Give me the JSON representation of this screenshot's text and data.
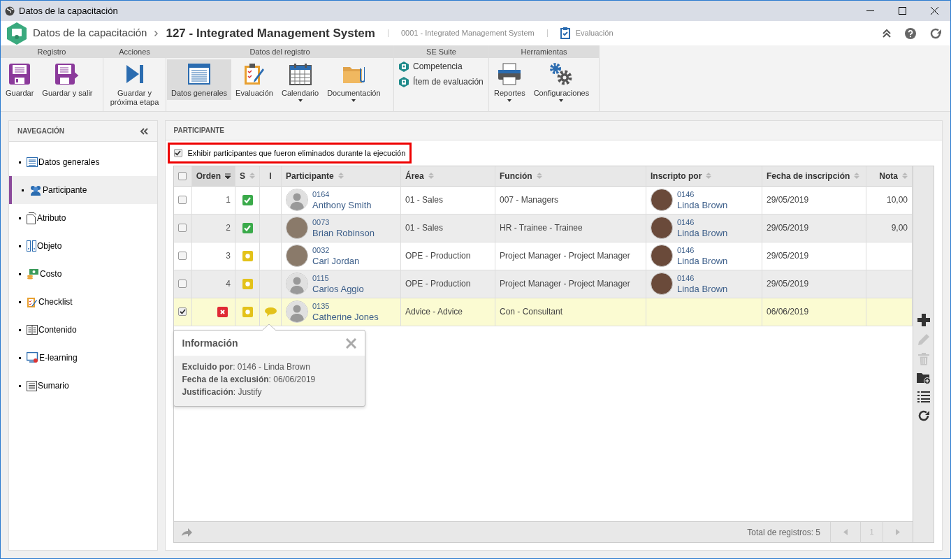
{
  "window": {
    "title": "Datos de la capacitación"
  },
  "header": {
    "module": "Datos de la capacitación",
    "record": "127 - Integrated Management System",
    "subrecord": "0001 - Integrated Management System",
    "step": "Evaluación"
  },
  "ribbon": [
    {
      "label": "Registro",
      "items": [
        {
          "kind": "large",
          "label": "Guardar",
          "selected": false,
          "dropdown": false
        },
        {
          "kind": "large",
          "label": "Guardar y salir",
          "selected": false,
          "dropdown": false
        }
      ]
    },
    {
      "label": "Acciones",
      "items": [
        {
          "kind": "large",
          "label": "Guardar y próxima etapa",
          "selected": false,
          "dropdown": false
        }
      ]
    },
    {
      "label": "Datos del registro",
      "items": [
        {
          "kind": "large",
          "label": "Datos generales",
          "selected": true,
          "dropdown": false
        },
        {
          "kind": "large",
          "label": "Evaluación",
          "selected": false,
          "dropdown": false
        },
        {
          "kind": "large",
          "label": "Calendario",
          "selected": false,
          "dropdown": true
        },
        {
          "kind": "large",
          "label": "Documentación",
          "selected": false,
          "dropdown": true
        }
      ]
    },
    {
      "label": "SE Suite",
      "items": [
        {
          "kind": "small",
          "label": "Competencia",
          "selected": false
        },
        {
          "kind": "small",
          "label": "Ítem de evaluación",
          "selected": false
        }
      ]
    },
    {
      "label": "Herramientas",
      "items": [
        {
          "kind": "large",
          "label": "Reportes",
          "selected": false,
          "dropdown": true
        },
        {
          "kind": "large",
          "label": "Configuraciones",
          "selected": false,
          "dropdown": true
        }
      ]
    }
  ],
  "navigation": {
    "title": "NAVEGACIÓN",
    "items": [
      {
        "label": "Datos generales",
        "selected": false
      },
      {
        "label": "Participante",
        "selected": true
      },
      {
        "label": "Atributo",
        "selected": false
      },
      {
        "label": "Objeto",
        "selected": false
      },
      {
        "label": "Costo",
        "selected": false
      },
      {
        "label": "Checklist",
        "selected": false
      },
      {
        "label": "Contenido",
        "selected": false
      },
      {
        "label": "E-learning",
        "selected": false
      },
      {
        "label": "Sumario",
        "selected": false
      }
    ]
  },
  "panel": {
    "title": "PARTICIPANTE",
    "show_deleted": {
      "label": "Exhibir participantes que fueron eliminados durante la ejecución",
      "checked": true
    },
    "table": {
      "all_checked": false,
      "columns": [
        {
          "label": "Orden",
          "sorted": true
        },
        {
          "label": "S",
          "sorted": false
        },
        {
          "label": "I",
          "sorted": false
        },
        {
          "label": "Participante",
          "sorted": false
        },
        {
          "label": "Área",
          "sorted": false
        },
        {
          "label": "Función",
          "sorted": false
        },
        {
          "label": "Inscripto por",
          "sorted": false
        },
        {
          "label": "Fecha de inscripción",
          "sorted": false
        },
        {
          "label": "Nota",
          "sorted": false
        }
      ],
      "rows": [
        {
          "checked": false,
          "excluded": false,
          "order": "1",
          "completed": true,
          "comment": false,
          "photo": false,
          "id": "0164",
          "name": "Anthony Smith",
          "area": "01 - Sales",
          "function": "007 - Managers",
          "enrolled_by_id": "0146",
          "enrolled_by": "Linda Brown",
          "date": "29/05/2019",
          "grade": "10,00"
        },
        {
          "checked": false,
          "excluded": false,
          "order": "2",
          "completed": true,
          "comment": false,
          "photo": true,
          "id": "0073",
          "name": "Brian Robinson",
          "area": "01 - Sales",
          "function": "HR - Trainee - Trainee",
          "enrolled_by_id": "0146",
          "enrolled_by": "Linda Brown",
          "date": "29/05/2019",
          "grade": "9,00"
        },
        {
          "checked": false,
          "excluded": false,
          "order": "3",
          "completed": false,
          "comment": false,
          "photo": true,
          "id": "0032",
          "name": "Carl Jordan",
          "area": "OPE - Production",
          "function": "Project Manager - Project Manager",
          "enrolled_by_id": "0146",
          "enrolled_by": "Linda Brown",
          "date": "29/05/2019"
        },
        {
          "checked": false,
          "excluded": false,
          "order": "4",
          "completed": false,
          "comment": false,
          "photo": false,
          "id": "0115",
          "name": "Carlos Aggio",
          "area": "OPE - Production",
          "function": "Project Manager - Project Manager",
          "enrolled_by_id": "0146",
          "enrolled_by": "Linda Brown",
          "date": "29/05/2019"
        },
        {
          "checked": true,
          "excluded": true,
          "completed": false,
          "comment": true,
          "photo": false,
          "id": "0135",
          "name": "Catherine Jones",
          "area": "Advice - Advice",
          "function": "Con - Consultant",
          "date": "06/06/2019"
        }
      ],
      "footer": {
        "total": "Total de registros: 5",
        "page": "1"
      }
    },
    "tools": [
      {
        "disabled": false
      },
      {
        "disabled": true
      },
      {
        "disabled": true
      },
      {
        "disabled": false
      },
      {
        "disabled": false
      },
      {
        "disabled": false
      }
    ],
    "popover": {
      "title": "Información",
      "lines": [
        "**Excluido por**: 0146 - Linda Brown",
        "**Fecha de la exclusión**: 06/06/2019",
        "**Justificación**: Justify"
      ]
    }
  }
}
